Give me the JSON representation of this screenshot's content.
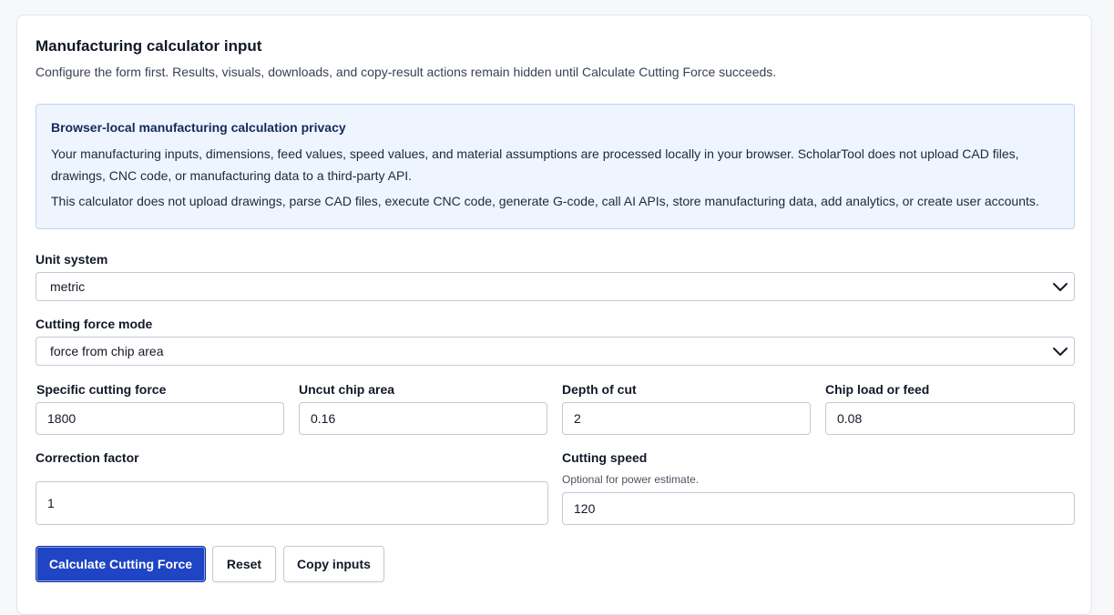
{
  "header": {
    "title": "Manufacturing calculator input",
    "subtitle": "Configure the form first. Results, visuals, downloads, and copy-result actions remain hidden until Calculate Cutting Force succeeds."
  },
  "privacy": {
    "title": "Browser-local manufacturing calculation privacy",
    "paragraph1": "Your manufacturing inputs, dimensions, feed values, speed values, and material assumptions are processed locally in your browser. ScholarTool does not upload CAD files, drawings, CNC code, or manufacturing data to a third-party API.",
    "paragraph2": "This calculator does not upload drawings, parse CAD files, execute CNC code, generate G-code, call AI APIs, store manufacturing data, add analytics, or create user accounts."
  },
  "form": {
    "unit_system": {
      "label": "Unit system",
      "value": "metric"
    },
    "cutting_force_mode": {
      "label": "Cutting force mode",
      "value": "force from chip area"
    },
    "specific_cutting_force": {
      "label": "Specific cutting force",
      "value": "1800"
    },
    "uncut_chip_area": {
      "label": "Uncut chip area",
      "value": "0.16"
    },
    "depth_of_cut": {
      "label": "Depth of cut",
      "value": "2"
    },
    "chip_load": {
      "label": "Chip load or feed",
      "value": "0.08"
    },
    "correction_factor": {
      "label": "Correction factor",
      "value": "1"
    },
    "cutting_speed": {
      "label": "Cutting speed",
      "hint": "Optional for power estimate.",
      "value": "120"
    }
  },
  "actions": {
    "calculate_label": "Calculate Cutting Force",
    "reset_label": "Reset",
    "copy_label": "Copy inputs"
  },
  "colors": {
    "primary": "#1f44c4",
    "privacy_bg": "#eef5ff",
    "privacy_border": "#bcd4f5"
  },
  "icons": {
    "select_arrow": "chevron-down-icon"
  }
}
